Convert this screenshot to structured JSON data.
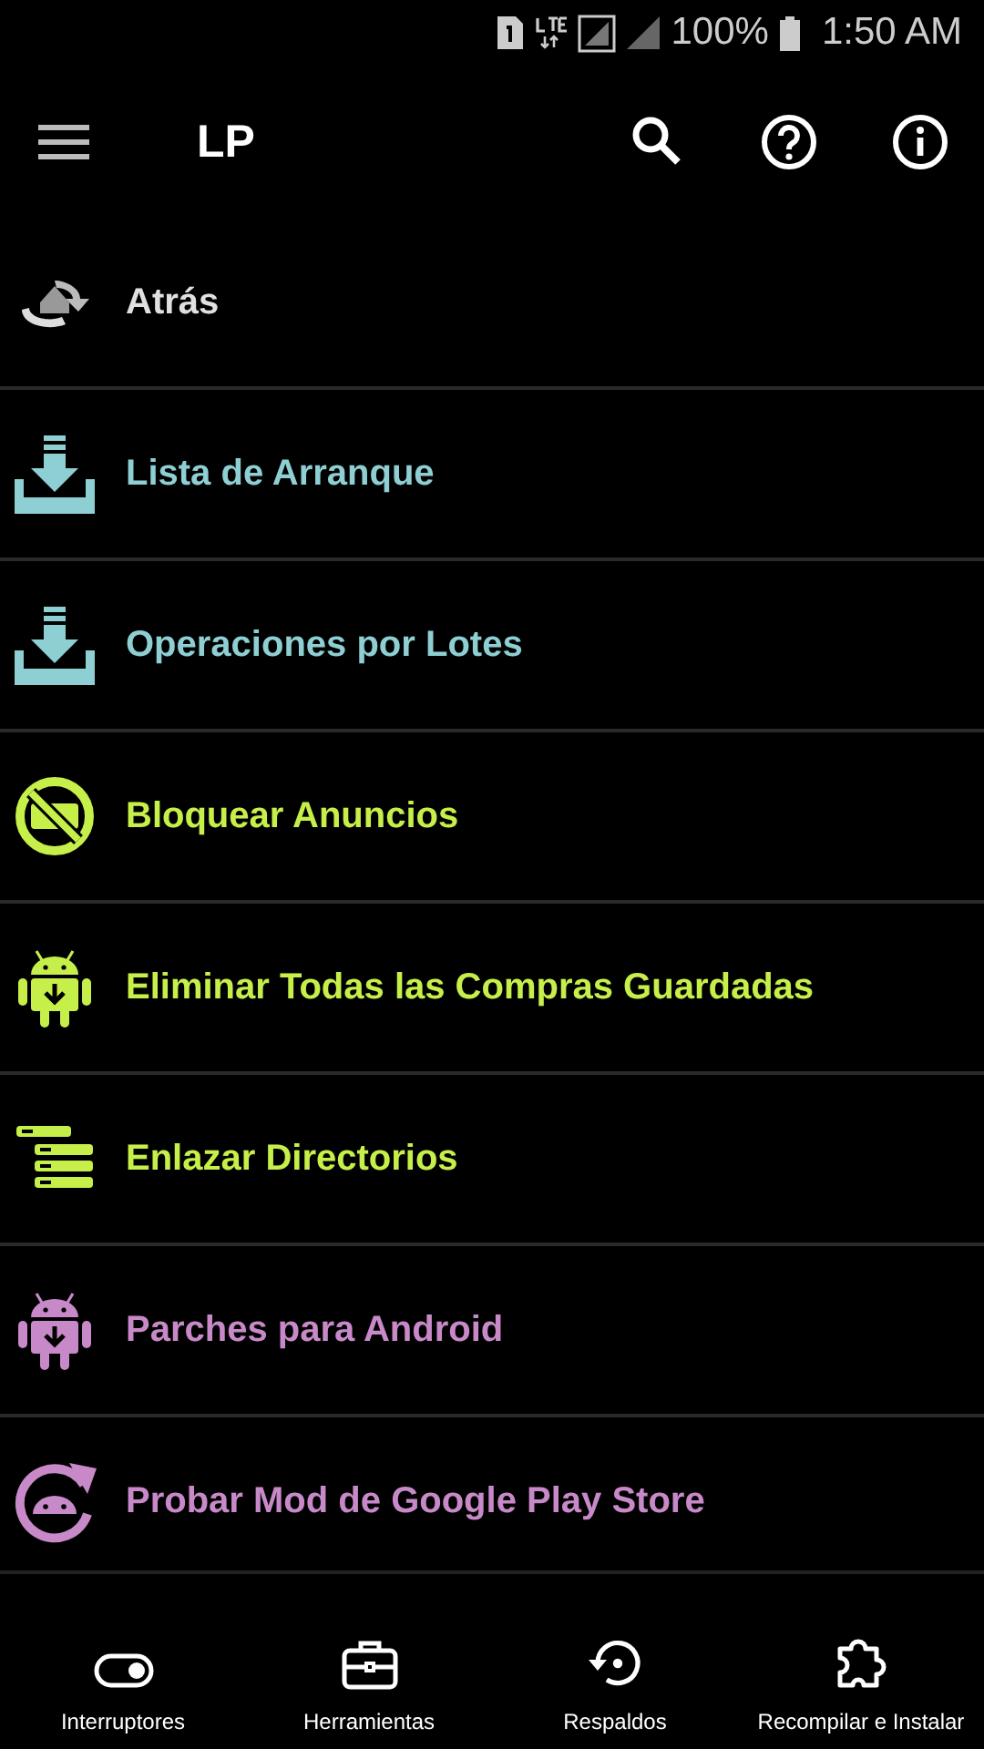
{
  "status_bar": {
    "battery": "100%",
    "time": "1:50 AM"
  },
  "toolbar": {
    "title": "LP"
  },
  "menu": [
    {
      "label": "Atrás",
      "kind": "back",
      "color": "#e0e0e0"
    },
    {
      "label": "Lista de Arranque",
      "kind": "download",
      "color": "#8ecfd3"
    },
    {
      "label": "Operaciones por Lotes",
      "kind": "download",
      "color": "#8ecfd3"
    },
    {
      "label": "Bloquear Anuncios",
      "kind": "noads",
      "color": "#c6ef4a"
    },
    {
      "label": "Eliminar Todas las Compras Guardadas",
      "kind": "android",
      "color": "#c6ef4a"
    },
    {
      "label": "Enlazar Directorios",
      "kind": "folders",
      "color": "#c6ef4a"
    },
    {
      "label": "Parches para Android",
      "kind": "android",
      "color": "#c889c8"
    },
    {
      "label": "Probar Mod de Google Play Store",
      "kind": "refresh",
      "color": "#c889c8"
    }
  ],
  "bottom_nav": [
    {
      "label": "Interruptores",
      "kind": "toggle"
    },
    {
      "label": "Herramientas",
      "kind": "toolbox"
    },
    {
      "label": "Respaldos",
      "kind": "restore"
    },
    {
      "label": "Recompilar e Instalar",
      "kind": "puzzle"
    }
  ]
}
